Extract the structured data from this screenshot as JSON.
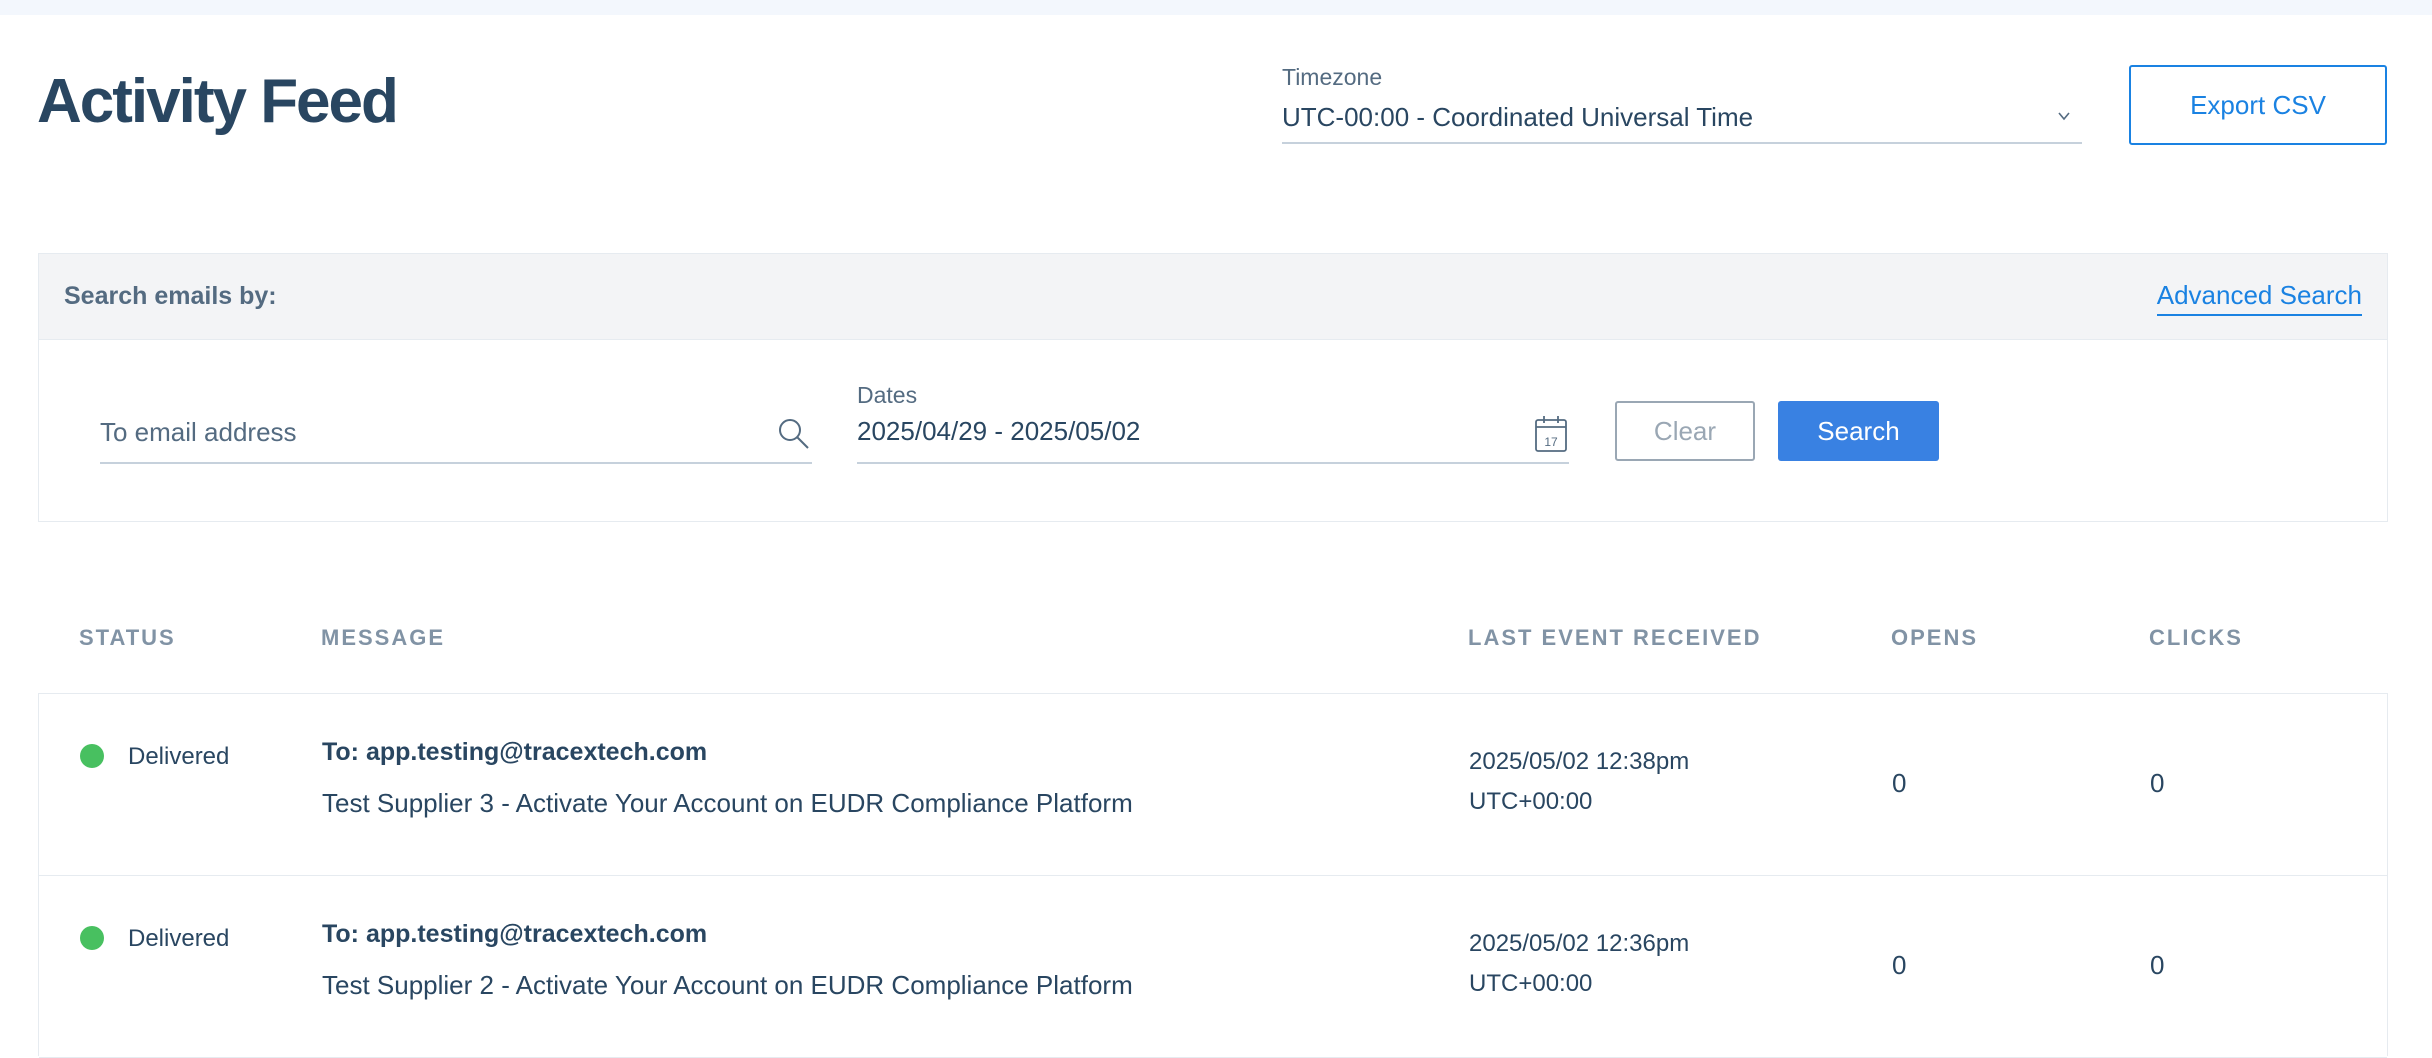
{
  "page": {
    "title": "Activity Feed"
  },
  "timezone": {
    "label": "Timezone",
    "value": "UTC-00:00 - Coordinated Universal Time"
  },
  "export_label": "Export CSV",
  "search": {
    "heading": "Search emails by:",
    "advanced_label": "Advanced Search",
    "email_placeholder": "To email address",
    "dates_label": "Dates",
    "dates_value": "2025/04/29 - 2025/05/02",
    "calendar_day": "17",
    "clear_label": "Clear",
    "search_label": "Search"
  },
  "table": {
    "columns": [
      "STATUS",
      "MESSAGE",
      "LAST EVENT RECEIVED",
      "OPENS",
      "CLICKS"
    ],
    "rows": [
      {
        "status": "Delivered",
        "to": "To: app.testing@tracextech.com",
        "subject": "Test Supplier 3 - Activate Your Account on EUDR Compliance Platform",
        "event_date": "2025/05/02 12:38pm",
        "event_tz": "UTC+00:00",
        "opens": "0",
        "clicks": "0"
      },
      {
        "status": "Delivered",
        "to": "To: app.testing@tracextech.com",
        "subject": "Test Supplier 2 - Activate Your Account on EUDR Compliance Platform",
        "event_date": "2025/05/02 12:36pm",
        "event_tz": "UTC+00:00",
        "opens": "0",
        "clicks": "0"
      }
    ]
  },
  "colors": {
    "primary": "#1a82e2",
    "search_button": "#3981e2",
    "text": "#294661",
    "muted": "#8193a5",
    "delivered": "#48c060"
  },
  "icons": {
    "email_field": "search-icon",
    "dates_field": "calendar-icon",
    "timezone_select": "chevron-down-icon",
    "status": "status-dot-icon"
  }
}
